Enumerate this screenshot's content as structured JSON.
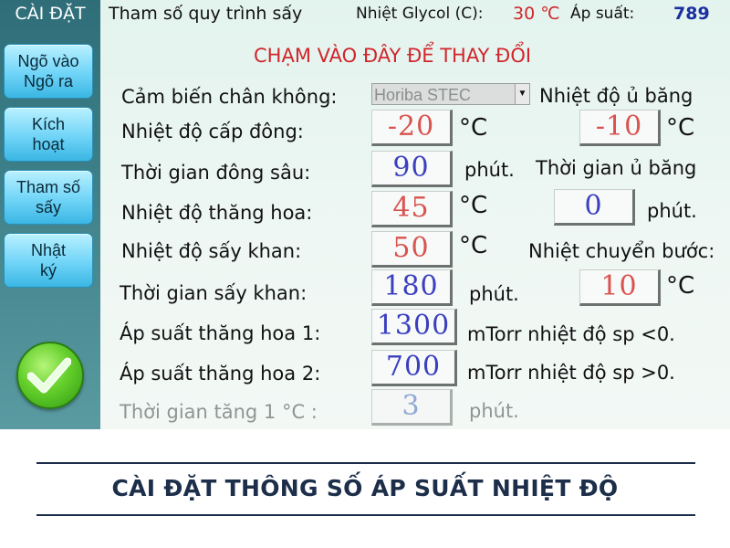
{
  "sidebar": {
    "title": "CÀI ĐẶT",
    "buttons": [
      {
        "label": "Ngõ vào\nNgõ ra"
      },
      {
        "label": "Kích\nhoạt"
      },
      {
        "label": "Tham số\nsấy"
      },
      {
        "label": "Nhật\nký"
      }
    ],
    "ok_icon": "check-icon"
  },
  "header": {
    "title": "Tham số quy trình sấy",
    "glycol_label": "Nhiệt Glycol (C):",
    "glycol_value": "30 ℃",
    "pressure_label": "Áp suất:",
    "pressure_value": "789"
  },
  "instruction": "CHẠM VÀO ĐÂY ĐỂ THAY ĐỔI",
  "vacuum_sensor": {
    "label": "Cảm biến chân không:",
    "selected": "Horiba STEC"
  },
  "params": {
    "freeze_temp": {
      "label": "Nhiệt độ cấp đông:",
      "value": "-20",
      "unit": "°C"
    },
    "deep_freeze_time": {
      "label": "Thời gian đông sâu:",
      "value": "90",
      "unit": "phút."
    },
    "sublimation_temp": {
      "label": "Nhiệt độ thăng hoa:",
      "value": "45",
      "unit": "°C"
    },
    "dry_temp": {
      "label": "Nhiệt độ sấy khan:",
      "value": "50",
      "unit": "°C"
    },
    "dry_time": {
      "label": "Thời gian sấy khan:",
      "value": "180",
      "unit": "phút."
    },
    "sub_pressure_1": {
      "label": "Áp suất thăng hoa 1:",
      "value": "1300",
      "unit": "mTorr nhiệt độ sp <0."
    },
    "sub_pressure_2": {
      "label": "Áp suất thăng hoa 2:",
      "value": "700",
      "unit": "mTorr nhiệt độ sp >0."
    },
    "ramp_time": {
      "label": "Thời gian tăng 1 °C :",
      "value": "3",
      "unit": "phút."
    }
  },
  "right_params": {
    "ice_temp": {
      "label": "Nhiệt độ ủ băng",
      "value": "-10",
      "unit": "°C"
    },
    "ice_time": {
      "label": "Thời gian ủ băng",
      "value": "0",
      "unit": "phút."
    },
    "step_temp": {
      "label": "Nhiệt chuyển bước:",
      "value": "10",
      "unit": "°C"
    }
  },
  "caption": "CÀI ĐẶT THÔNG SỐ ÁP SUẤT NHIỆT ĐỘ",
  "colors": {
    "sidebar": "#3d7f88",
    "button": "#6fd4f7",
    "value_red": "#d9534f",
    "value_blue": "#3b3fbf",
    "instruction_red": "#d0262b",
    "caption": "#1c2e4a"
  }
}
